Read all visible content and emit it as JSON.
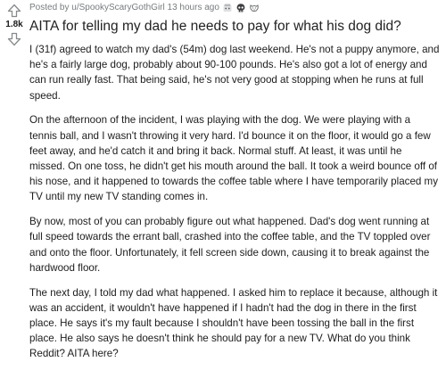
{
  "vote": {
    "score": "1.8k"
  },
  "meta": {
    "posted_by": "Posted by u/SpookyScaryGothGirl",
    "time": "13 hours ago"
  },
  "awards": [
    "wholesome-award-icon",
    "skull-award-icon",
    "dog-award-icon"
  ],
  "post": {
    "title": "AITA for telling my dad he needs to pay for what his dog did?",
    "paragraphs": [
      "I (31f) agreed to watch my dad's (54m) dog last weekend. He's not a puppy anymore, and he's a fairly large dog, probably about 90-100 pounds. He's also got a lot of energy and can run really fast. That being said, he's not very good at stopping when he runs at full speed.",
      "On the afternoon of the incident, I was playing with the dog. We were playing with a tennis ball, and I wasn't throwing it very hard. I'd bounce it on the floor, it would go a few feet away, and he'd catch it and bring it back. Normal stuff. At least, it was until he missed. On one toss, he didn't get his mouth around the ball. It took a weird bounce off of his nose, and it happened to towards the coffee table where I have temporarily placed my TV until my new TV standing comes in.",
      "By now, most of you can probably figure out what happened. Dad's dog went running at full speed towards the errant ball, crashed into the coffee table, and the TV toppled over and onto the floor. Unfortunately, it fell screen side down, causing it to break against the hardwood floor.",
      "The next day, I told my dad what happened. I asked him to replace it because, although it was an accident, it wouldn't have happened if I hadn't had the dog in there in the first place. He says it's my fault because I shouldn't have been tossing the ball in the first place. He also says he doesn't think he should pay for a new TV. What do you think Reddit? AITA here?"
    ]
  }
}
